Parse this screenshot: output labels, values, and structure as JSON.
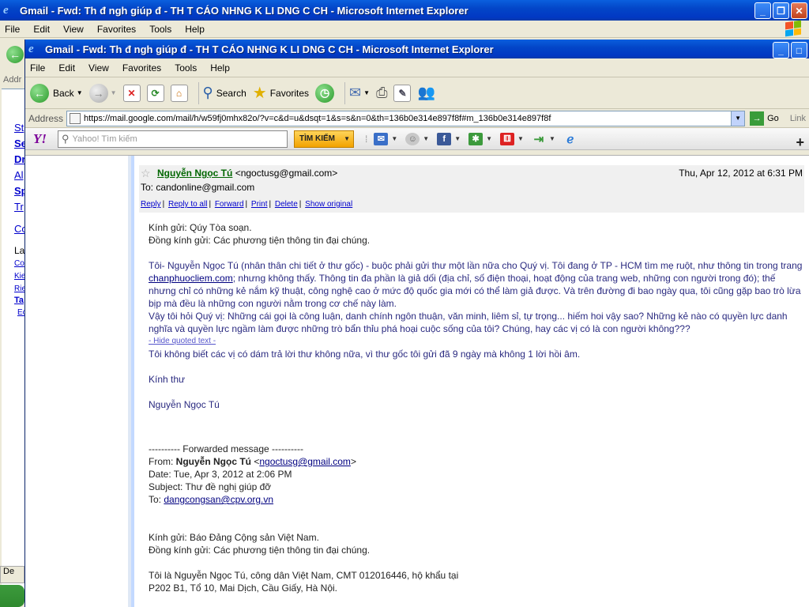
{
  "back_window": {
    "title": "Gmail - Fwd: Th\u001f đ\u001f ngh\u001f giúp đ\u001f - TH\u001f T\u001f CÁO NH\u001fNG K\u001f L\u001fI D\u001fNG C\u001f CH\u001f - Microsoft Internet Explorer",
    "menu": [
      "File",
      "Edit",
      "View",
      "Favorites",
      "Tools",
      "Help"
    ],
    "address_label": "Addr",
    "side_links": [
      "St",
      "Se",
      "Dr",
      "Al",
      "Sp",
      "Tr",
      "Co",
      "La",
      "Co",
      "Kie",
      "Rie",
      "Ta",
      "Ec"
    ],
    "taskbar_item": "De"
  },
  "front_window": {
    "title": "Gmail - Fwd: Th\u001f đ\u001f ngh\u001f giúp đ\u001f - TH\u001f T\u001f CÁO NH\u001fNG K\u001f L\u001fI D\u001fNG C\u001f CH\u001f - Microsoft Internet Explorer",
    "menu": [
      "File",
      "Edit",
      "View",
      "Favorites",
      "Tools",
      "Help"
    ],
    "toolbar": {
      "back": "Back",
      "search": "Search",
      "favorites": "Favorites"
    },
    "address": {
      "label": "Address",
      "url": "https://mail.google.com/mail/h/w59fj0mhx82o/?v=c&d=u&dsqt=1&s=s&n=0&th=136b0e314e897f8f#m_136b0e314e897f8f",
      "go": "Go",
      "links": "Link"
    },
    "yahoo": {
      "logo": "Y!",
      "search_placeholder": "Yahoo! Tìm kiếm",
      "search_button": "TÌM KIẾM"
    }
  },
  "email": {
    "from_name": "Nguyễn Ngọc Tú",
    "from_email": "<ngoctusg@gmail.com>",
    "date": "Thu, Apr 12, 2012 at 6:31 PM",
    "to": "To: candonline@gmail.com",
    "actions": [
      "Reply",
      "Reply to all",
      "Forward",
      "Print",
      "Delete",
      "Show original"
    ],
    "greeting1": "Kính gửi: Qúy Tòa soạn.",
    "greeting2": "Đồng kính gửi: Các phương tiện thông tin đại chúng.",
    "para1_a": "Tôi- Nguyễn Ngọc Tú (nhân thân chi tiết ở thư gốc) - buộc phải gửi thư một lần nữa cho Quý vị. Tôi đang ở TP - HCM tìm mẹ ruột, như thông tin trong trang ",
    "para1_link": "chanphuocliem.com",
    "para1_b": "; nhưng không thấy. Thông tin đa phần là giả dối (địa chỉ, số điện thoại, hoạt động của trang web, những con người trong đó); thế nhưng chỉ có những kẻ nắm kỹ thuật, công nghệ cao ở mức độ quốc gia mới có thể làm giả được. Và trên đường đi bao ngày qua, tôi cũng gặp bao trò lừa bịp mà đều là những con người nằm trong cơ chế này làm.",
    "para2": "Vậy tôi hỏi Quý vị: Những cái gọi là công luận, danh chính ngôn thuận, văn minh, liêm sỉ, tự trọng... hiếm hoi vậy sao? Những kẻ nào có quyền lực danh nghĩa và quyền lực ngầm làm được những trò bẩn thỉu phá hoại cuộc sống của tôi? Chúng, hay các vị có là con người không???",
    "hide_quoted": "- Hide quoted text -",
    "para3": "Tôi không biết các vị có dám trả lời thư không nữa, vì thư gốc tôi gửi đã 9 ngày mà không 1 lời hồi âm.",
    "closing": "Kính thư",
    "signature": "Nguyễn Ngọc Tú",
    "forwarded": {
      "header": "---------- Forwarded message ----------",
      "from_label": "From: ",
      "from_name": "Nguyễn Ngọc Tú",
      "from_email": "ngoctusg@gmail.com",
      "date": "Date: Tue, Apr 3, 2012 at 2:06 PM",
      "subject": "Subject: Thư đề nghị giúp đỡ",
      "to_label": "To: ",
      "to_email": "dangcongsan@cpv.org.vn",
      "greeting1": "Kính gửi: Báo Đảng Cộng sản Việt Nam.",
      "greeting2": "Đồng kính gửi: Các phương tiện thông tin đại chúng.",
      "intro1": "Tôi là Nguyễn Ngọc Tú, công dân Việt Nam, CMT 012016446, hộ khẩu tại",
      "intro2": "P202 B1, Tổ 10, Mai Dịch, Cầu Giấy, Hà Nội."
    }
  }
}
